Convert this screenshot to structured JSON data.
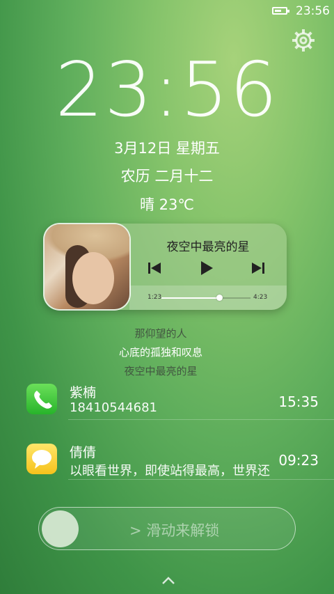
{
  "status_bar": {
    "time": "23:56"
  },
  "lock_screen": {
    "clock": "23:56",
    "date": "3月12日 星期五",
    "lunar_date": "农历 二月十二",
    "weather": "晴 23℃"
  },
  "music": {
    "song_title": "夜空中最亮的星",
    "elapsed": "1:23",
    "total": "4:23",
    "progress": 0.65,
    "lyrics": [
      "那仰望的人",
      "心底的孤独和叹息",
      "夜空中最亮的星"
    ]
  },
  "notifications": [
    {
      "title": "紫楠",
      "body": "18410544681",
      "time": "15:35",
      "icon": "phone-icon",
      "accent": "#3cc43a"
    },
    {
      "title": "倩倩",
      "body": "以眼看世界，即使站得最高，世界还",
      "time": "09:23",
      "icon": "message-icon",
      "accent": "#f8d12e"
    }
  ],
  "unlock": {
    "arrow": ">",
    "label": "滑动来解锁"
  }
}
